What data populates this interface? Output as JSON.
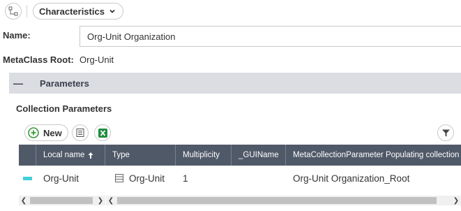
{
  "toolbar": {
    "view_icon": "workflow-icon",
    "view_dropdown_label": "Characteristics"
  },
  "form": {
    "name_label": "Name:",
    "name_value": "Org-Unit Organization",
    "metaclass_label": "MetaClass Root:",
    "metaclass_value": "Org-Unit"
  },
  "section": {
    "toggle_symbol": "—",
    "title": "Parameters"
  },
  "collection": {
    "title": "Collection Parameters",
    "new_button_label": "New"
  },
  "grid": {
    "columns": [
      {
        "label": "Local name",
        "sort": "ascending"
      },
      {
        "label": "Type"
      },
      {
        "label": "Multiplicity"
      },
      {
        "label": "_GUIName"
      },
      {
        "label": "MetaCollectionParameter Populating collection"
      }
    ],
    "rows": [
      {
        "local_name": "Org-Unit",
        "type": "Org-Unit",
        "multiplicity": "1",
        "guiname": "",
        "populating_collection": "Org-Unit Organization_Root"
      }
    ]
  },
  "colors": {
    "header_bg": "#505968",
    "section_bg": "#dcdde2",
    "row_marker": "#3fd0d8",
    "new_icon": "#3c9a3c",
    "excel_icon": "#1e8e3e"
  }
}
